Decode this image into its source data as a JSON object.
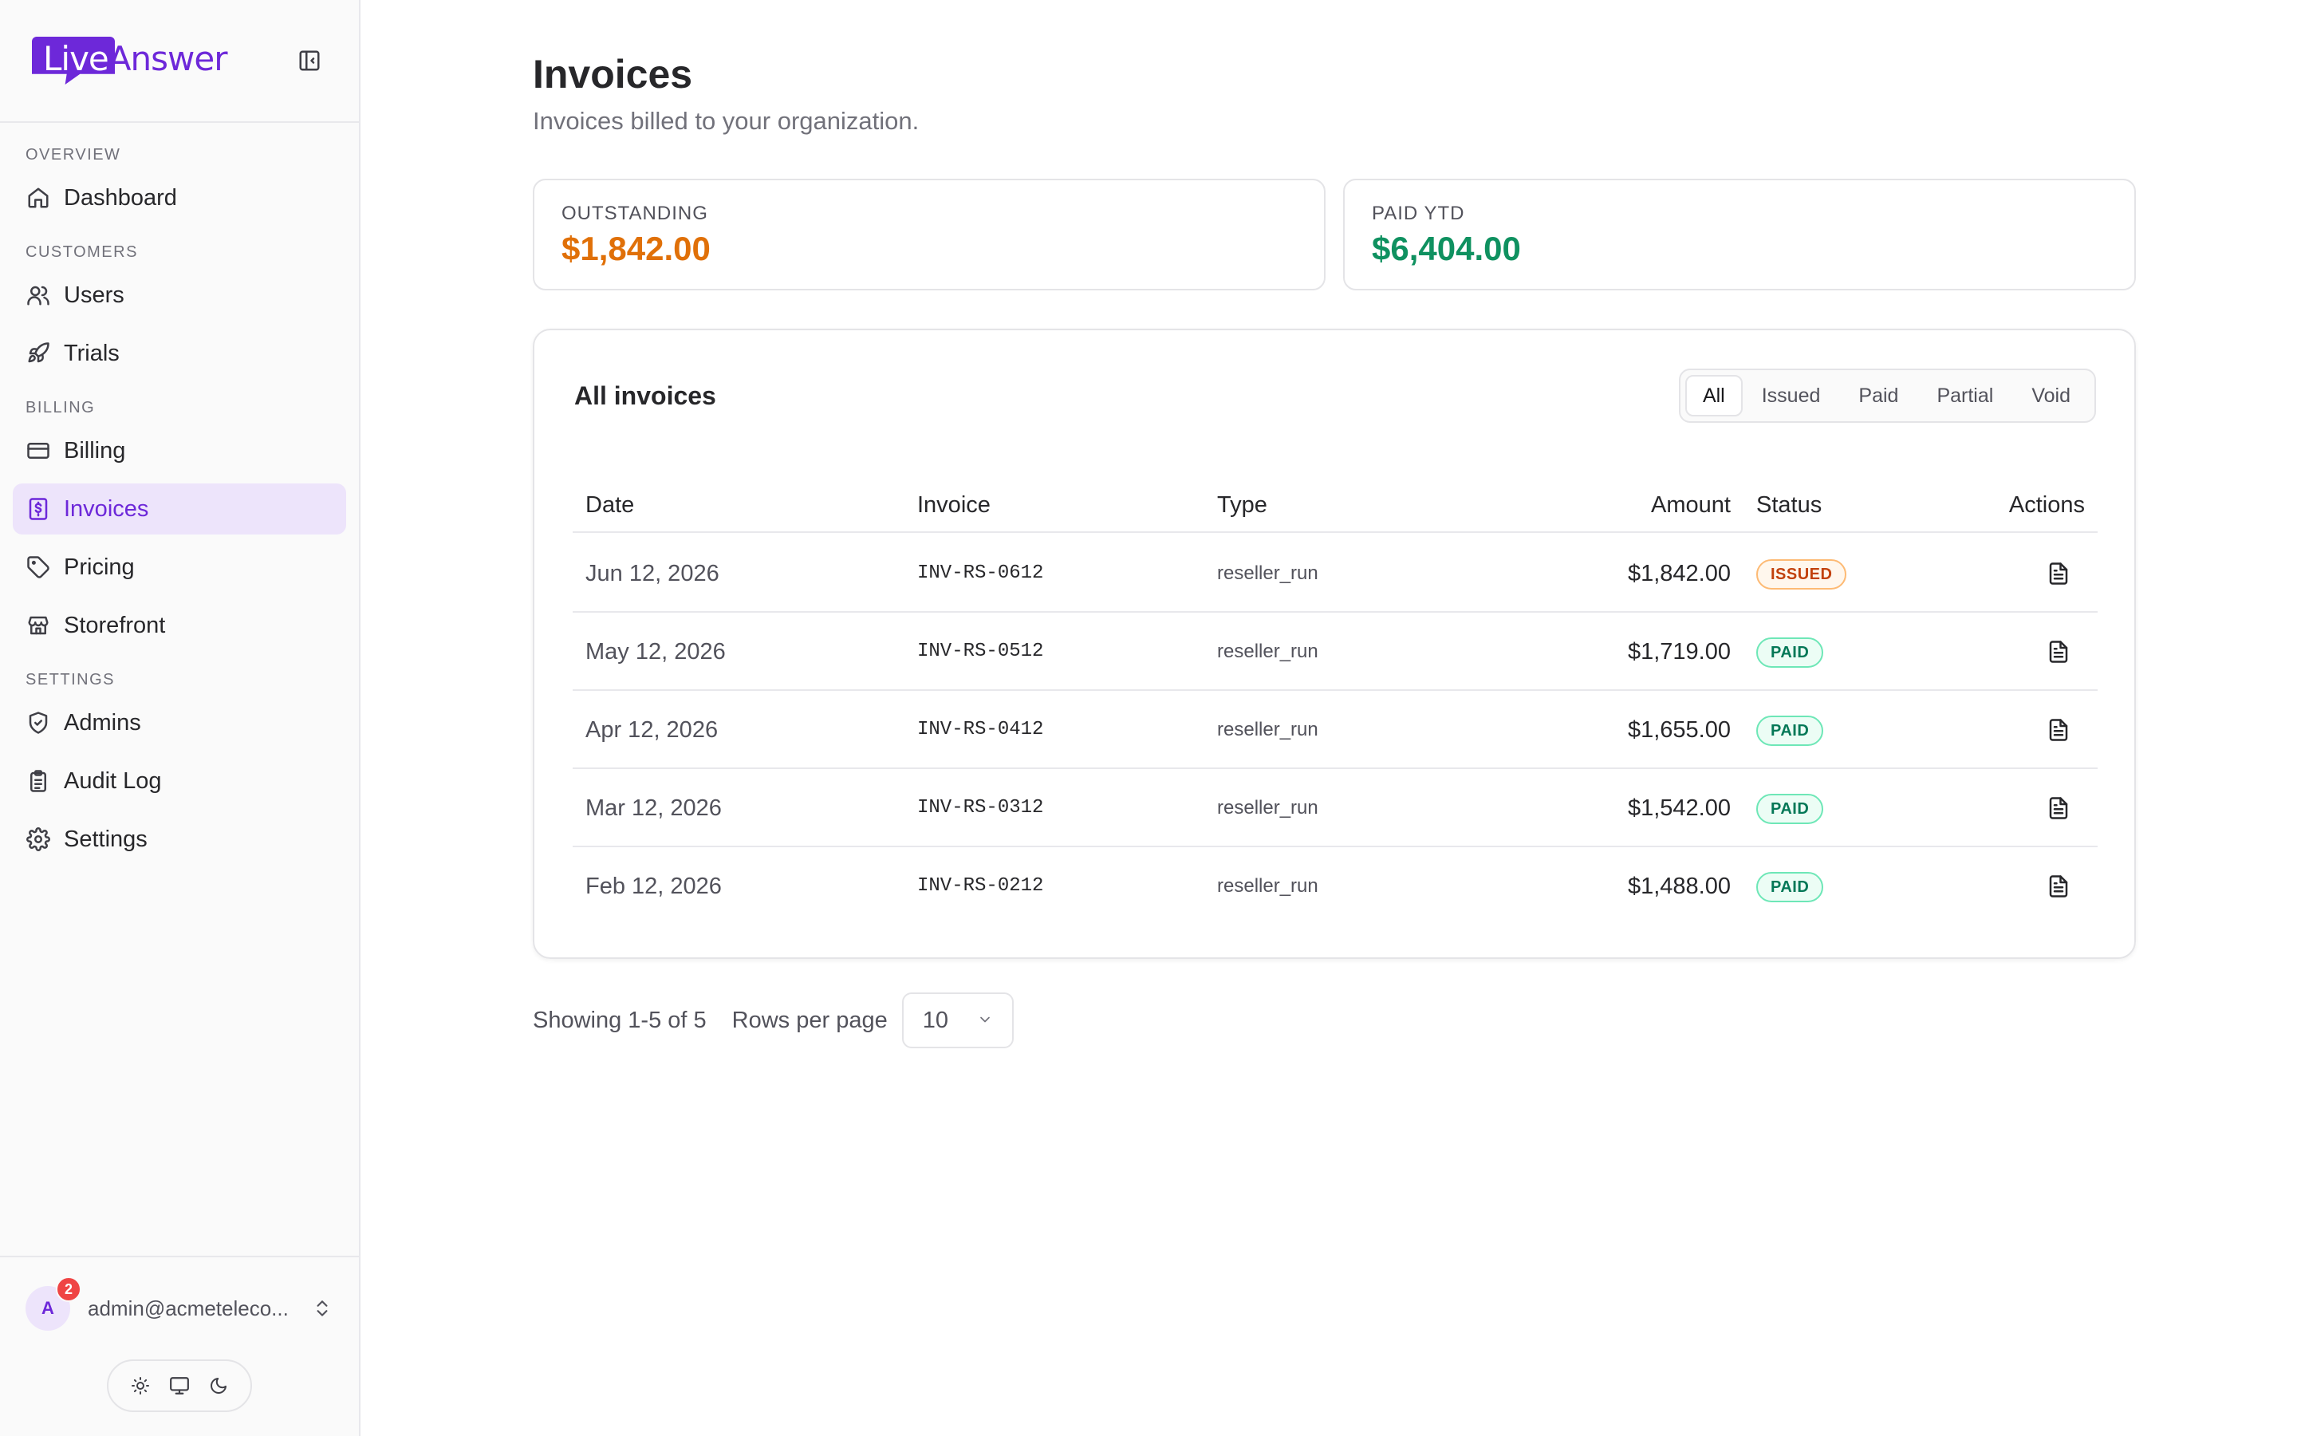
{
  "brand": {
    "live": "Live",
    "answer": "Answer"
  },
  "sidebar": {
    "sections": [
      {
        "label": "OVERVIEW",
        "items": [
          {
            "label": "Dashboard",
            "icon": "home-icon"
          }
        ]
      },
      {
        "label": "CUSTOMERS",
        "items": [
          {
            "label": "Users",
            "icon": "users-icon"
          },
          {
            "label": "Trials",
            "icon": "rocket-icon"
          }
        ]
      },
      {
        "label": "BILLING",
        "items": [
          {
            "label": "Billing",
            "icon": "credit-card-icon"
          },
          {
            "label": "Invoices",
            "icon": "receipt-dollar-icon"
          },
          {
            "label": "Pricing",
            "icon": "tag-icon"
          },
          {
            "label": "Storefront",
            "icon": "store-icon"
          }
        ]
      },
      {
        "label": "SETTINGS",
        "items": [
          {
            "label": "Admins",
            "icon": "shield-check-icon"
          },
          {
            "label": "Audit Log",
            "icon": "clipboard-icon"
          },
          {
            "label": "Settings",
            "icon": "gear-icon"
          }
        ]
      }
    ],
    "active_item": "Invoices",
    "user": {
      "initial": "A",
      "email": "admin@acmeteleco...",
      "notifications": "2"
    }
  },
  "page": {
    "title": "Invoices",
    "subtitle": "Invoices billed to your organization."
  },
  "stats": {
    "outstanding": {
      "label": "OUTSTANDING",
      "value": "$1,842.00",
      "color": "#e07008"
    },
    "paid_ytd": {
      "label": "PAID YTD",
      "value": "$6,404.00",
      "color": "#0f9160"
    }
  },
  "table": {
    "title": "All invoices",
    "filters": [
      "All",
      "Issued",
      "Paid",
      "Partial",
      "Void"
    ],
    "active_filter": "All",
    "columns": {
      "date": "Date",
      "invoice": "Invoice",
      "type": "Type",
      "amount": "Amount",
      "status": "Status",
      "actions": "Actions"
    },
    "rows": [
      {
        "date": "Jun 12, 2026",
        "invoice": "INV-RS-0612",
        "type": "reseller_run",
        "amount": "$1,842.00",
        "status": "ISSUED"
      },
      {
        "date": "May 12, 2026",
        "invoice": "INV-RS-0512",
        "type": "reseller_run",
        "amount": "$1,719.00",
        "status": "PAID"
      },
      {
        "date": "Apr 12, 2026",
        "invoice": "INV-RS-0412",
        "type": "reseller_run",
        "amount": "$1,655.00",
        "status": "PAID"
      },
      {
        "date": "Mar 12, 2026",
        "invoice": "INV-RS-0312",
        "type": "reseller_run",
        "amount": "$1,542.00",
        "status": "PAID"
      },
      {
        "date": "Feb 12, 2026",
        "invoice": "INV-RS-0212",
        "type": "reseller_run",
        "amount": "$1,488.00",
        "status": "PAID"
      }
    ]
  },
  "pagination": {
    "showing": "Showing 1-5 of 5",
    "rows_label": "Rows per page",
    "rows_value": "10"
  }
}
